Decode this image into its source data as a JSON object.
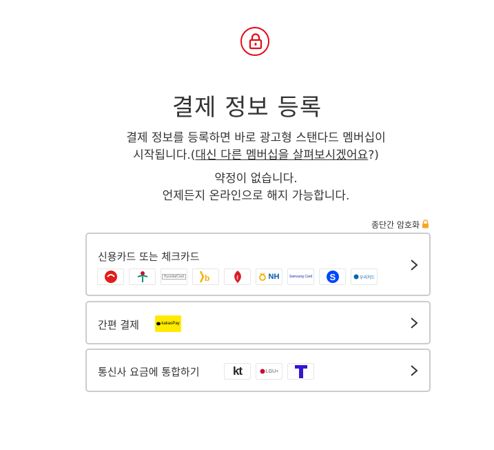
{
  "header": {
    "title": "결제 정보 등록",
    "desc_line1": "결제 정보를 등록하면 바로 광고형 스탠다드 멤버십이",
    "desc_line2_prefix": "시작됩니다.(",
    "desc_link": "대신 다른 멤버십을 살펴보시겠어요",
    "desc_line2_suffix": "?)",
    "note_line1": "약정이 없습니다.",
    "note_line2": "언제든지 온라인으로 해지 가능합니다.",
    "encryption_label": "종단간 암호화",
    "accent_color": "#e50914"
  },
  "payment_options": [
    {
      "label": "신용카드 또는 체크카드",
      "logos": [
        "롯데카드",
        "하나카드",
        "HyundaiCard",
        "KB국민카드",
        "롯데",
        "NH",
        "Samsung Card",
        "신한카드",
        "우리카드"
      ]
    },
    {
      "label": "간편 결제",
      "logos": [
        "kakaoPay"
      ]
    },
    {
      "label": "통신사 요금에 통합하기",
      "logos": [
        "kt",
        "LGU+",
        "T"
      ]
    }
  ]
}
